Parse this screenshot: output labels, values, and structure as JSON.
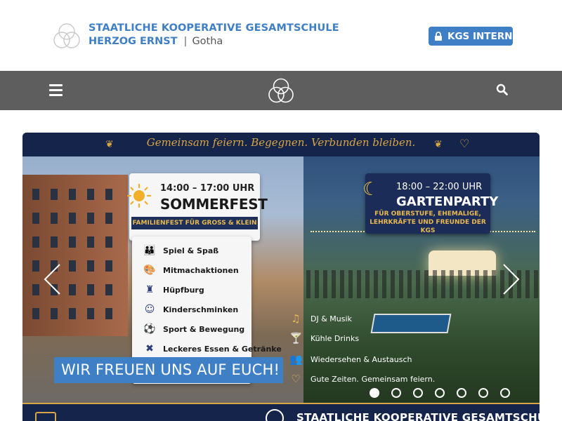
{
  "header": {
    "school_name": "STAATLICHE KOOPERATIVE GESAMTSCHULE",
    "school_subname": "HERZOG ERNST",
    "separator": "|",
    "city": "Gotha",
    "intern_button": "KGS INTERN"
  },
  "navbar": {
    "menu_icon": "hamburger-menu-icon",
    "logo_icon": "rings-logo-icon",
    "search_icon": "search-icon"
  },
  "slider": {
    "tagline": "Gemeinsam feiern. Begegnen. Verbunden bleiben.",
    "sommerfest": {
      "time": "14:00 – 17:00 UHR",
      "title": "SOMMERFEST",
      "subtitle": "FAMILIENFEST FÜR GROSS & KLEIN",
      "activities": [
        {
          "icon": "people-icon",
          "label": "Spiel & Spaß"
        },
        {
          "icon": "palette-icon",
          "label": "Mitmachaktionen"
        },
        {
          "icon": "castle-icon",
          "label": "Hüpfburg"
        },
        {
          "icon": "face-icon",
          "label": "Kinderschminken"
        },
        {
          "icon": "ball-icon",
          "label": "Sport & Bewegung"
        },
        {
          "icon": "cutlery-icon",
          "label": "Leckeres Essen & Getränke"
        }
      ]
    },
    "gartenparty": {
      "time": "18:00 – 22:00 UHR",
      "title": "GARTENPARTY",
      "subtitle": "FÜR OBERSTUFE, EHEMALIGE, LEHRKRÄFTE UND FREUNDE DER KGS",
      "features": [
        {
          "icon": "music-icon",
          "label": "DJ & Musik"
        },
        {
          "icon": "cocktail-icon",
          "label": "Kühle Drinks"
        },
        {
          "icon": "group-icon",
          "label": "Wiedersehen & Austausch"
        },
        {
          "icon": "heart-icon",
          "label": "Gute Zeiten. Gemeinsam feiern."
        }
      ]
    },
    "caption": "WIR FREUEN UNS AUF EUCH!",
    "bottom_text": "STAATLICHE KOOPERATIVE GESAMTSCHULE",
    "slide_count": 7,
    "active_slide": 1
  },
  "colors": {
    "brand_blue": "#3f7fc6",
    "nav_gray": "#5e5e5e",
    "navy": "#14244a",
    "gold": "#d7a545"
  }
}
